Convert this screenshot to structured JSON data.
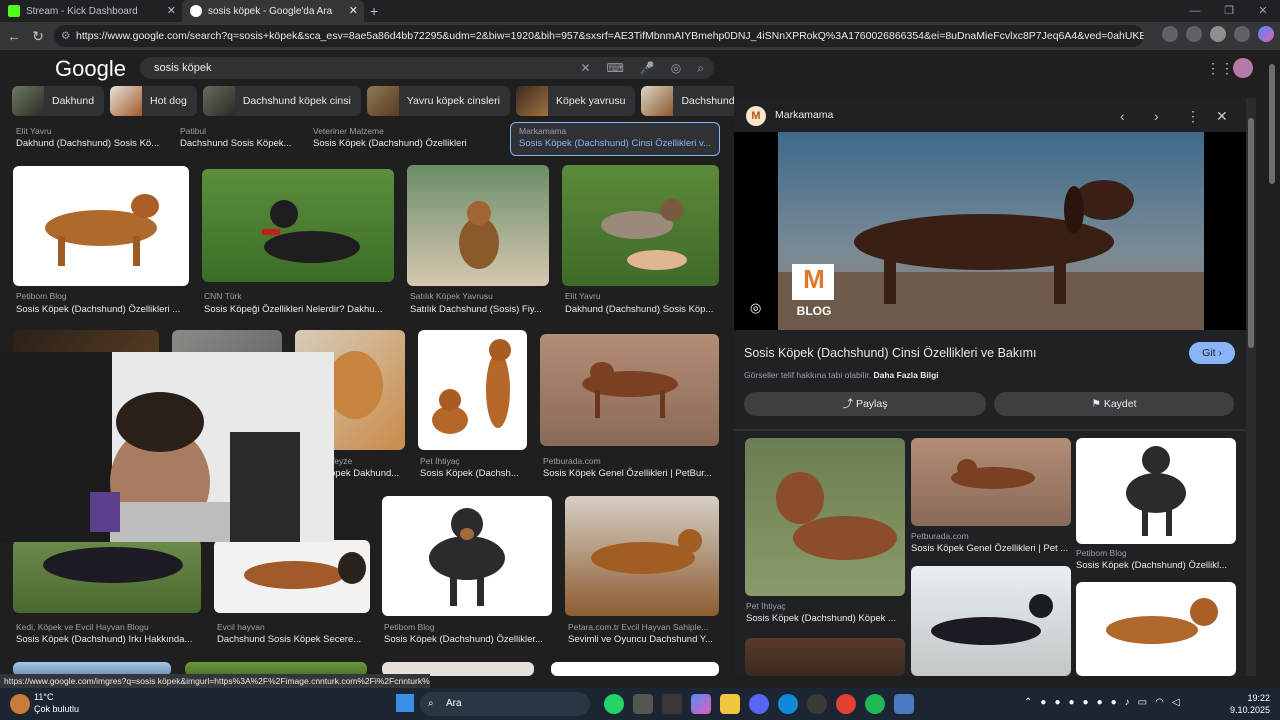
{
  "browser": {
    "tabs": [
      {
        "title": "Stream - Kick Dashboard",
        "color": "#53fc18"
      },
      {
        "title": "sosis köpek - Google'da Ara",
        "color": "#ffffff"
      }
    ],
    "url": "https://www.google.com/search?q=sosis+köpek&sca_esv=8ae5a86d4bb72295&udm=2&biw=1920&bih=957&sxsrf=AE3TifMbnmAIYBmehp0DNJ_4iSNnXPRokQ%3A1760026866354&ei=8uDnaMieFcvlxc8P7Jeq6A4&ved=0ahUKEwjl36eBw5eQAxXLxcE...",
    "status_url": "https://www.google.com/imgres?q=sosis köpek&imgurl=https%3A%2F%2Fimage.cnnturk.com%2Fi%2Fcnnturk%2F7..."
  },
  "google": {
    "logo": "Google",
    "query": "sosis köpek",
    "chips": [
      "Dakhund",
      "Hot dog",
      "Dachshund köpek cinsi",
      "Yavru köpek cinsleri",
      "Köpek yavrusu",
      "Dachshund yavru"
    ]
  },
  "results": {
    "row0": [
      {
        "src": "Elit Yavru",
        "cap": "Dakhund (Dachshund) Sosis Kö..."
      },
      {
        "src": "Patibul",
        "cap": "Dachshund Sosis Köpek..."
      },
      {
        "src": "Veteriner Malzeme",
        "cap": "Sosis Köpek (Dachshund) Özellikleri"
      },
      {
        "src": "Markamama",
        "cap": "Sosis Köpek (Dachshund) Cinsi Özellikleri v..."
      }
    ],
    "row1": [
      {
        "src": "Petibom Blog",
        "cap": "Sosis Köpek (Dachshund) Özellikleri ..."
      },
      {
        "src": "CNN Türk",
        "cap": "Sosis Köpeği Özellikleri Nelerdir? Dakhu..."
      },
      {
        "src": "Satılık Köpek Yavrusu",
        "cap": "Satılık Dachshund (Sosis) Fiy..."
      },
      {
        "src": "Elit Yavru",
        "cap": "Dakhund (Dachshund) Sosis Köp..."
      }
    ],
    "row2": [
      {
        "src": "Teyze",
        "cap": "öpek Dakhund..."
      },
      {
        "src": "Pet İhtiyaç",
        "cap": "Sosis Köpek (Dachsh..."
      },
      {
        "src": "Petburada.com",
        "cap": "Sosis Köpek Genel Özellikleri | PetBur..."
      }
    ],
    "row3": [
      {
        "src": "Kedi, Köpek ve Evcil Hayvan Blogu",
        "cap": "Sosis Köpek (Dachshund) Irkı Hakkında..."
      },
      {
        "src": "Evcil hayvan",
        "cap": "Dachshund Sosis Köpek Secere..."
      },
      {
        "src": "Petibom Blog",
        "cap": "Sosis Köpek (Dachshund) Özellikler..."
      },
      {
        "src": "Petara.com.tr Evcil Hayvan Sahiple...",
        "cap": "Sevimli ve Oyuncu Dachshund Y..."
      }
    ]
  },
  "panel": {
    "source": "Markamama",
    "logo_letter": "M",
    "logo_text": "BLOG",
    "title": "Sosis Köpek (Dachshund) Cinsi Özellikleri ve Bakımı",
    "visit": "Git",
    "copyright": "Görseller telif hakkına tabi olabilir.",
    "more_info": "Daha Fazla Bilgi",
    "share": "Paylaş",
    "save": "Kaydet",
    "related": [
      {
        "src": "Pet İhtiyaç",
        "cap": "Sosis Köpek (Dachshund) Köpek ..."
      },
      {
        "src": "Petburada.com",
        "cap": "Sosis Köpek Genel Özellikleri | Pet ..."
      },
      {
        "src": "Petibom Blog",
        "cap": "Sosis Köpek (Dachshund) Özellikl..."
      }
    ]
  },
  "taskbar": {
    "temp": "11°C",
    "weather": "Çok bulutlu",
    "search": "Ara",
    "time": "19:22",
    "date": "9.10.2025"
  }
}
